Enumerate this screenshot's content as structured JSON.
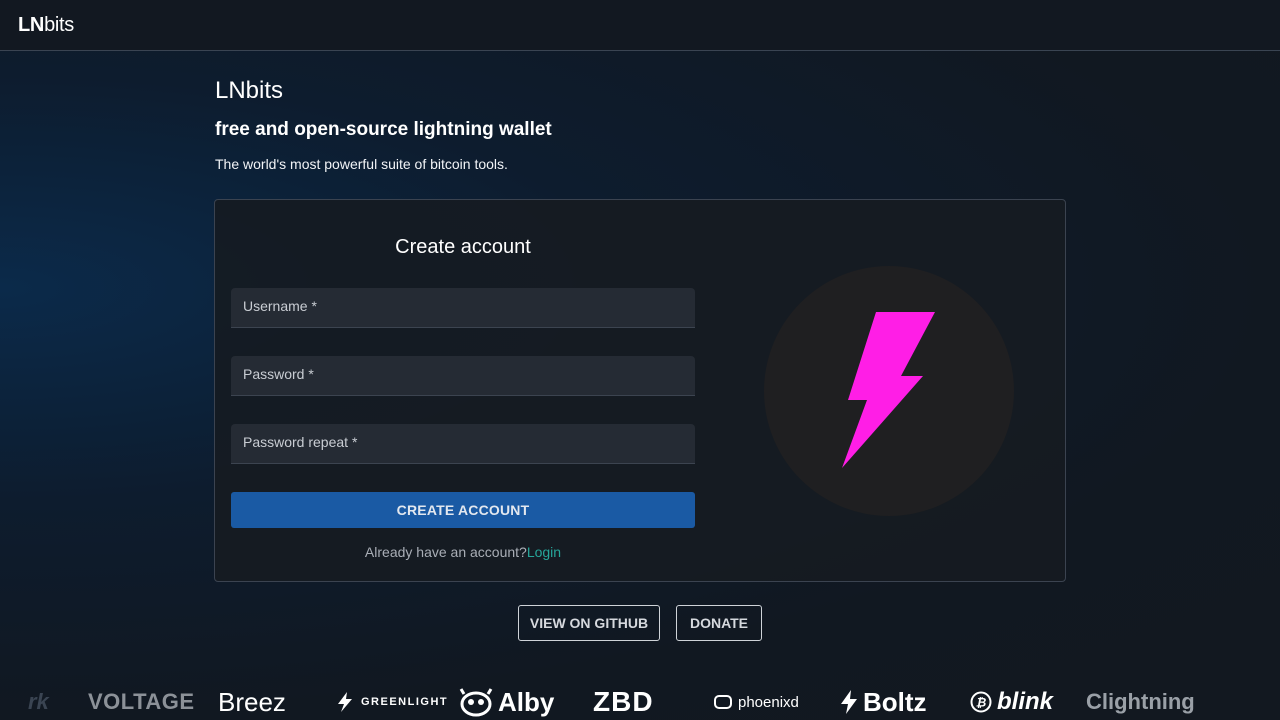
{
  "header": {
    "brand_bold": "LN",
    "brand_rest": "bits"
  },
  "hero": {
    "title": "LNbits",
    "subtitle": "free and open-source lightning wallet",
    "description": "The world's most powerful suite of bitcoin tools."
  },
  "form": {
    "title": "Create account",
    "username_label": "Username *",
    "password_label": "Password *",
    "password_repeat_label": "Password repeat *",
    "submit_label": "CREATE ACCOUNT",
    "login_prompt": "Already have an account?",
    "login_link": "Login"
  },
  "logo": {
    "icon": "lightning-bolt-icon",
    "color": "#ff1ee6",
    "circle_color": "#1f1f21"
  },
  "actions": {
    "github_label": "VIEW ON GITHUB",
    "donate_label": "DONATE"
  },
  "partners": {
    "items": [
      "rk",
      "VOLTAGE",
      "Breez",
      "GREENLIGHT",
      "Alby",
      "ZBD",
      "phoenixd",
      "Boltz",
      "blink",
      "Clightning"
    ]
  },
  "colors": {
    "primary": "#1a5aa4",
    "link": "#26a69a",
    "accent": "#ff1ee6"
  }
}
